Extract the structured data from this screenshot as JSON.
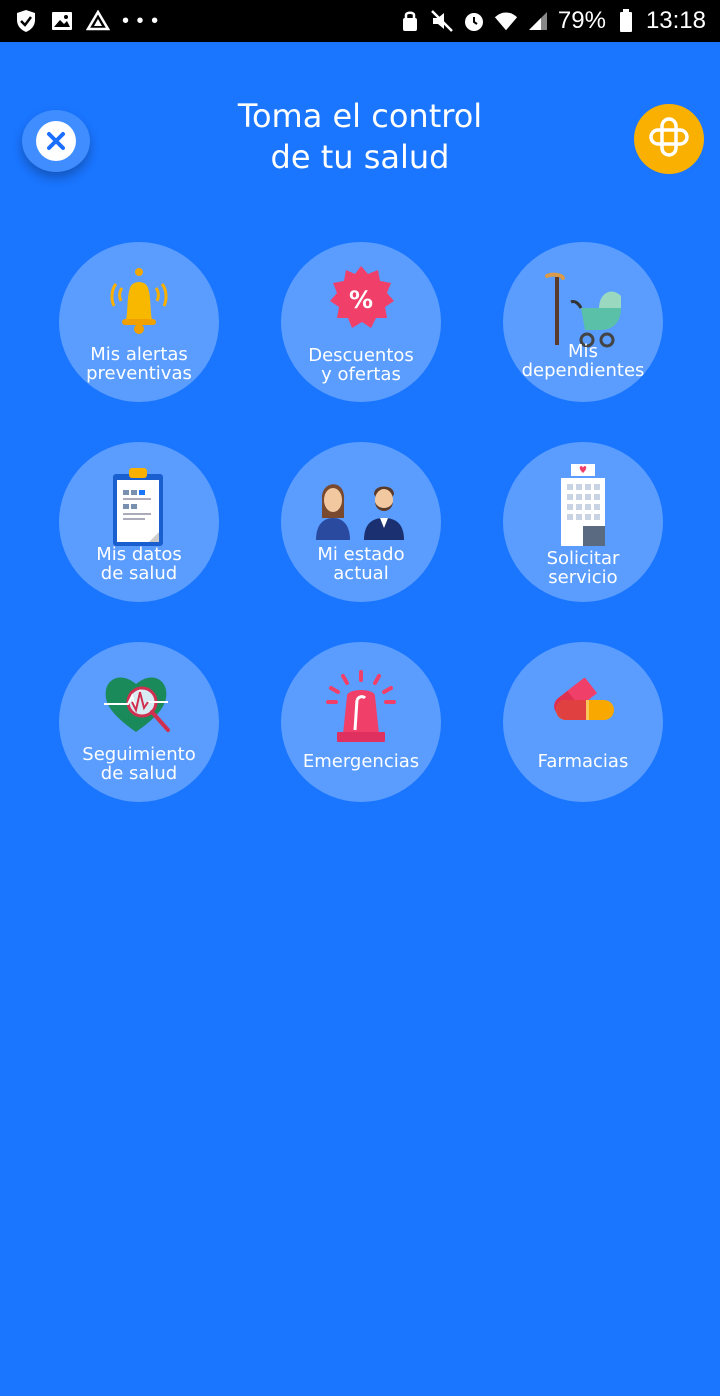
{
  "status_bar": {
    "left_icons": [
      "shield-icon",
      "image-icon",
      "drive-icon"
    ],
    "dots": "• • •",
    "right_icons": [
      "lock-icon",
      "mute-icon",
      "alarm-icon",
      "wifi-icon",
      "signal-icon",
      "battery-icon"
    ],
    "battery": "79%",
    "time": "13:18"
  },
  "header": {
    "title": "Toma el control\nde tu salud",
    "close_icon": "close-icon",
    "brand_icon": "cross-logo-icon",
    "colors": {
      "background": "#1a75ff",
      "tile": "#5a9dff",
      "brand": "#f9b000"
    }
  },
  "tiles": [
    {
      "label": "Mis alertas\npreventivas",
      "icon": "bell-icon"
    },
    {
      "label": "Descuentos\ny ofertas",
      "icon": "discount-badge-icon"
    },
    {
      "label": "Mis\ndependientes",
      "icon": "cane-stroller-icon"
    },
    {
      "label": "Mis datos\nde salud",
      "icon": "clipboard-icon"
    },
    {
      "label": "Mi estado\nactual",
      "icon": "couple-icon"
    },
    {
      "label": "Solicitar\nservicio",
      "icon": "hospital-icon"
    },
    {
      "label": "Seguimiento\nde salud",
      "icon": "heart-monitor-icon"
    },
    {
      "label": "Emergencias",
      "icon": "siren-icon"
    },
    {
      "label": "Farmacias",
      "icon": "pill-icon"
    }
  ]
}
